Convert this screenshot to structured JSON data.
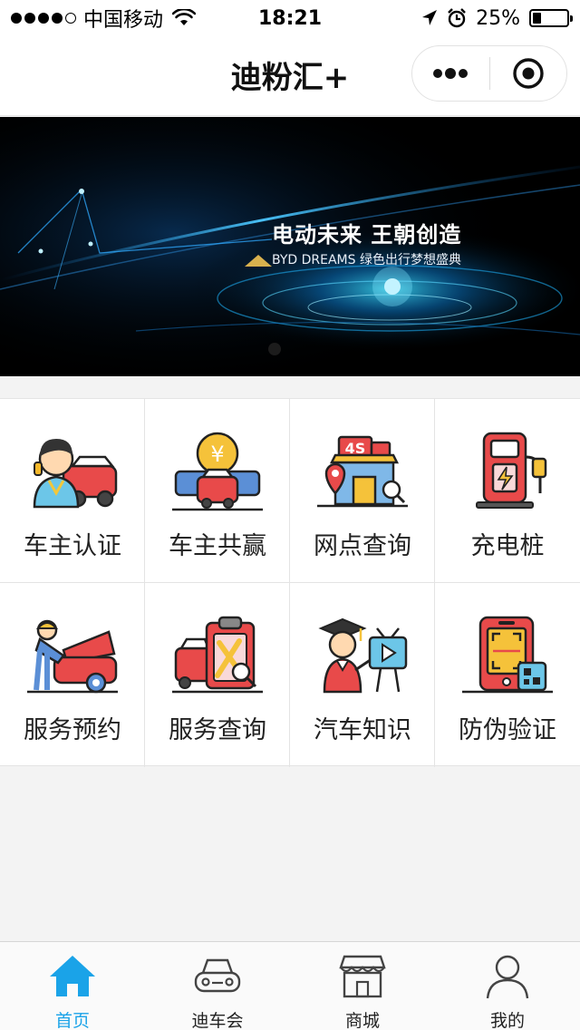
{
  "status_bar": {
    "carrier": "中国移动",
    "time": "18:21",
    "battery": "25%",
    "battery_level": 0.25
  },
  "nav": {
    "title": "迪粉汇+"
  },
  "banner": {
    "title": "电动未来 王朝创造",
    "subtitle": "BYD DREAMS 绿色出行梦想盛典"
  },
  "grid": {
    "items": [
      {
        "label": "车主认证",
        "icon": "car-owner-icon"
      },
      {
        "label": "车主共赢",
        "icon": "cars-coin-icon"
      },
      {
        "label": "网点查询",
        "icon": "4s-store-icon"
      },
      {
        "label": "充电桩",
        "icon": "charging-pile-icon"
      },
      {
        "label": "服务预约",
        "icon": "mechanic-icon"
      },
      {
        "label": "服务查询",
        "icon": "service-clipboard-icon"
      },
      {
        "label": "汽车知识",
        "icon": "graduate-video-icon"
      },
      {
        "label": "防伪验证",
        "icon": "phone-scan-icon"
      }
    ]
  },
  "tabbar": {
    "items": [
      {
        "label": "首页",
        "icon": "home-icon",
        "active": true
      },
      {
        "label": "迪车会",
        "icon": "car-icon",
        "active": false
      },
      {
        "label": "商城",
        "icon": "store-icon",
        "active": false
      },
      {
        "label": "我的",
        "icon": "user-icon",
        "active": false
      }
    ]
  },
  "colors": {
    "accent": "#1aa3e8",
    "banner_bg": "#000000",
    "grid_bg": "#ffffff",
    "page_bg": "#f3f3f3"
  }
}
